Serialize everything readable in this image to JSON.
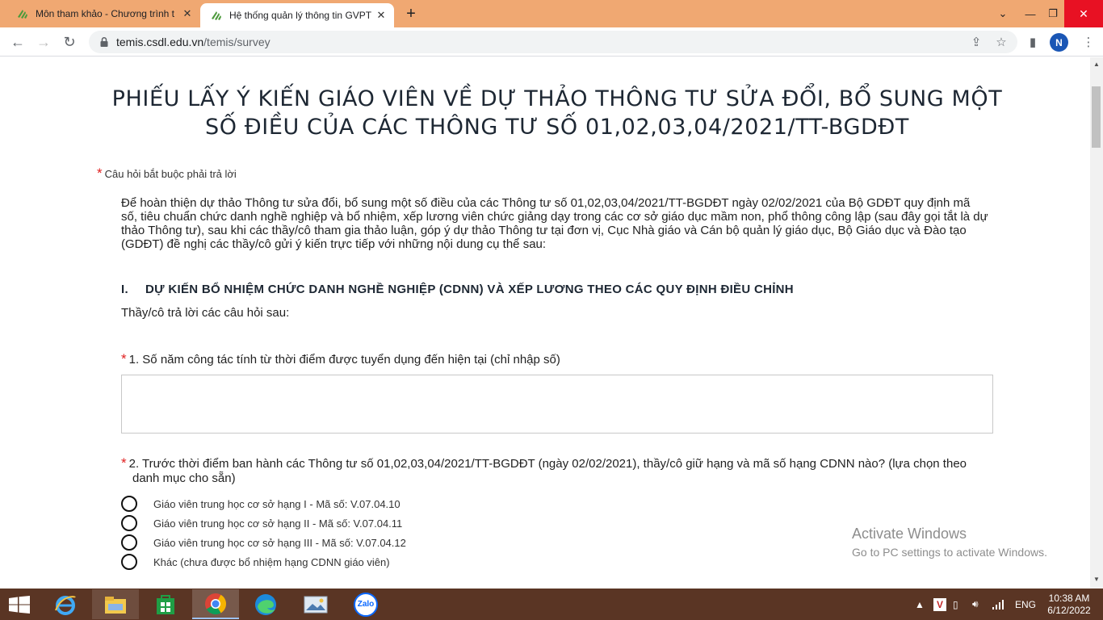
{
  "browser": {
    "tabs": [
      {
        "title": "Môn tham khảo - Chương trình t",
        "active": false
      },
      {
        "title": "Hệ thống quản lý thông tin GVPT",
        "active": true
      }
    ],
    "new_tab": "+",
    "url_host": "temis.csdl.edu.vn",
    "url_path": "/temis/survey",
    "profile_initial": "N"
  },
  "page": {
    "title_line1": "PHIẾU LẤY Ý KIẾN GIÁO VIÊN VỀ DỰ THẢO THÔNG TƯ SỬA ĐỔI, BỔ SUNG MỘT",
    "title_line2": "SỐ ĐIỀU CỦA CÁC THÔNG TƯ SỐ 01,02,03,04/2021/TT-BGDĐT",
    "required_star": "*",
    "required_note": "Câu hỏi bắt buộc phải trả lời",
    "intro": "Để hoàn thiện dự thảo Thông tư sửa đổi, bổ sung một số điều của các Thông tư số 01,02,03,04/2021/TT-BGDĐT ngày 02/02/2021 của Bộ GDĐT quy định mã số, tiêu chuẩn chức danh nghề nghiệp và bổ nhiệm, xếp lương viên chức giảng dạy trong các cơ sở giáo dục mầm non, phổ thông công lập (sau đây gọi tắt là dự thảo Thông tư), sau khi các thầy/cô tham gia thảo luận, góp ý dự thảo Thông tư tại đơn vị, Cục Nhà giáo và Cán bộ quản lý giáo dục, Bộ Giáo dục và Đào tạo (GDĐT) đề nghị các thầy/cô gửi ý kiến trực tiếp với những nội dung cụ thể sau:",
    "section": {
      "number": "I.",
      "heading": "DỰ KIẾN BỔ NHIỆM CHỨC DANH NGHỀ NGHIỆP (CDNN) VÀ XẾP LƯƠNG THEO CÁC QUY ĐỊNH ĐIỀU CHỈNH",
      "prompt": "Thầy/cô trả lời các câu hỏi sau:"
    },
    "questions": [
      {
        "label": "1. Số năm công tác tính từ thời điểm được tuyển dụng đến hiện tại (chỉ nhập số)",
        "value": ""
      },
      {
        "label": "2. Trước thời điểm ban hành các Thông tư số 01,02,03,04/2021/TT-BGDĐT (ngày 02/02/2021), thầy/cô giữ hạng và mã số hạng CDNN nào? (lựa chọn theo danh mục cho sẵn)",
        "options": [
          "Giáo viên trung học cơ sở hạng I - Mã số: V.07.04.10",
          "Giáo viên trung học cơ sở hạng II - Mã số: V.07.04.11",
          "Giáo viên trung học cơ sở hạng III - Mã số: V.07.04.12",
          "Khác (chưa được bổ nhiệm hạng CDNN giáo viên)"
        ]
      }
    ],
    "watermark_title": "Activate Windows",
    "watermark_sub": "Go to PC settings to activate Windows."
  },
  "taskbar": {
    "apps": [
      "ie-icon",
      "file-explorer-icon",
      "store-icon",
      "chrome-icon",
      "edge-icon",
      "photos-icon",
      "zalo-icon"
    ],
    "zalo_label": "Zalo",
    "tray_lang": "ENG",
    "time": "10:38 AM",
    "date": "6/12/2022"
  },
  "colors": {
    "tabstrip": "#f0a872",
    "required": "#e02020",
    "taskbar": "#5a3524",
    "avatar": "#1a56b5"
  }
}
